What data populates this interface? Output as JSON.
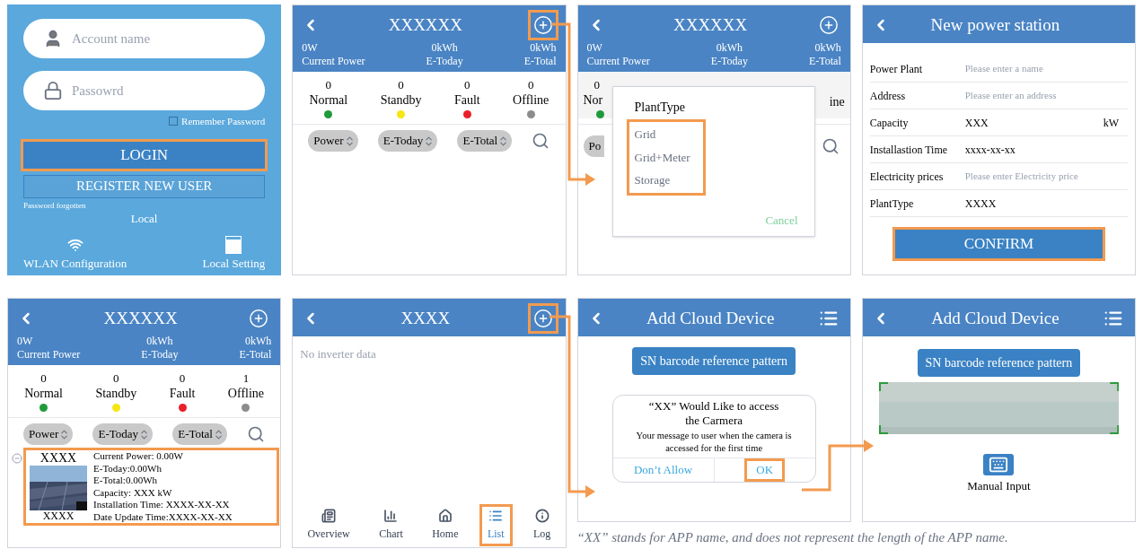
{
  "screens": [
    {
      "kind": "login",
      "account": {
        "placeholder": "Account name"
      },
      "password": {
        "placeholder": "Passowrd"
      },
      "remember": {
        "label": "Remember Password",
        "checked": false
      },
      "login": {
        "label": "LOGIN",
        "highlighted": true
      },
      "register": {
        "label": "REGISTER NEW USER"
      },
      "forgot": "Password forgotten",
      "local": "Local",
      "tools": [
        {
          "kind": "wifi",
          "label": "WLAN Configuration"
        },
        {
          "kind": "device",
          "label": "Local Setting"
        }
      ]
    },
    {
      "kind": "plants",
      "header": {
        "title": "XXXXXX",
        "action": {
          "kind": "add",
          "highlighted": true
        },
        "stats": [
          {
            "value": "0W",
            "label": "Current Power"
          },
          {
            "value": "0kWh",
            "label": "E-Today"
          },
          {
            "value": "0kWh",
            "label": "E-Total"
          }
        ]
      },
      "statuses": [
        {
          "count": "0",
          "label": "Normal",
          "color": "#1f9a3c"
        },
        {
          "count": "0",
          "label": "Standby",
          "color": "#f5e614"
        },
        {
          "count": "0",
          "label": "Fault",
          "color": "#e8202a"
        },
        {
          "count": "0",
          "label": "Offline",
          "color": "#8c8c8c"
        }
      ],
      "sorts": [
        {
          "label": "Power"
        },
        {
          "label": "E-Today"
        },
        {
          "label": "E-Total"
        }
      ]
    },
    {
      "kind": "plant_type",
      "header": {
        "title": "XXXXXX",
        "action": {
          "kind": "add",
          "highlighted": false
        },
        "stats": [
          {
            "value": "0W",
            "label": "Current Power"
          },
          {
            "value": "0kWh",
            "label": "E-Today"
          },
          {
            "value": "0kWh",
            "label": "E-Total"
          }
        ]
      },
      "behind": {
        "count": "0",
        "label": "Nor",
        "color": "#1f9a3c",
        "right_label": "ine",
        "sort": "Po"
      },
      "dialog": {
        "title": "PlantType",
        "options": [
          "Grid",
          "Grid+Meter",
          "Storage"
        ],
        "options_highlighted": true,
        "cancel": "Cancel"
      }
    },
    {
      "kind": "new_station",
      "header": {
        "title": "New power station"
      },
      "fields": [
        {
          "label": "Power Plant",
          "placeholder": "Please enter a name"
        },
        {
          "label": "Address",
          "placeholder": "Please enter an address"
        },
        {
          "label": "Capacity",
          "value": "XXX",
          "unit": "kW"
        },
        {
          "label": "Installastion Time",
          "value": "xxxx-xx-xx"
        },
        {
          "label": "Electricity prices",
          "placeholder": "Please enter Electricity price"
        },
        {
          "label": "PlantType",
          "value": "XXXX"
        }
      ],
      "confirm": {
        "label": "CONFIRM",
        "highlighted": true
      }
    },
    {
      "kind": "plants",
      "header": {
        "title": "XXXXXX",
        "action": {
          "kind": "add",
          "highlighted": false
        },
        "stats": [
          {
            "value": "0W",
            "label": "Current Power"
          },
          {
            "value": "0kWh",
            "label": "E-Today"
          },
          {
            "value": "0kWh",
            "label": "E-Total"
          }
        ]
      },
      "statuses": [
        {
          "count": "0",
          "label": "Normal",
          "color": "#1f9a3c"
        },
        {
          "count": "0",
          "label": "Standby",
          "color": "#f5e614"
        },
        {
          "count": "0",
          "label": "Fault",
          "color": "#e8202a"
        },
        {
          "count": "1",
          "label": "Offline",
          "color": "#8c8c8c"
        }
      ],
      "sorts": [
        {
          "label": "Power"
        },
        {
          "label": "E-Today"
        },
        {
          "label": "E-Total"
        }
      ],
      "plant": {
        "name": "XXXX",
        "caption": "XXXX",
        "highlighted": true,
        "details": [
          "Current Power: 0.00W",
          "E-Today:0.00Wh",
          "E-Total:0.00Wh",
          "Capacity: XXX kW",
          "Installation Time: XXXX-XX-XX",
          "Date Update Time:XXXX-XX-XX"
        ]
      }
    },
    {
      "kind": "inverters",
      "header": {
        "title": "XXXX",
        "action": {
          "kind": "add",
          "highlighted": true
        }
      },
      "empty": "No inverter data",
      "tabs": [
        {
          "kind": "overview",
          "label": "Overview",
          "selected": false,
          "highlighted": false
        },
        {
          "kind": "chart",
          "label": "Chart",
          "selected": false,
          "highlighted": false
        },
        {
          "kind": "home",
          "label": "Home",
          "selected": false,
          "highlighted": false
        },
        {
          "kind": "list",
          "label": "List",
          "selected": true,
          "highlighted": true
        },
        {
          "kind": "log",
          "label": "Log",
          "selected": false,
          "highlighted": false
        }
      ]
    },
    {
      "kind": "camera_permission",
      "header": {
        "title": "Add Cloud Device",
        "action": {
          "kind": "list",
          "highlighted": false
        }
      },
      "sn_button": "SN barcode reference pattern",
      "alert": {
        "title": "“XX” Would Like to access the Carmera",
        "message": "Your message to user when the camera is accessed for the first time",
        "buttons": [
          {
            "label": "Don’t Allow",
            "highlighted": false
          },
          {
            "label": "OK",
            "highlighted": true
          }
        ]
      }
    },
    {
      "kind": "scanner",
      "header": {
        "title": "Add Cloud Device",
        "action": {
          "kind": "list",
          "highlighted": false
        }
      },
      "sn_button": "SN barcode reference pattern",
      "manual": "Manual Input"
    }
  ],
  "caption": "“XX” stands for APP name, and does not represent the length of the APP name."
}
